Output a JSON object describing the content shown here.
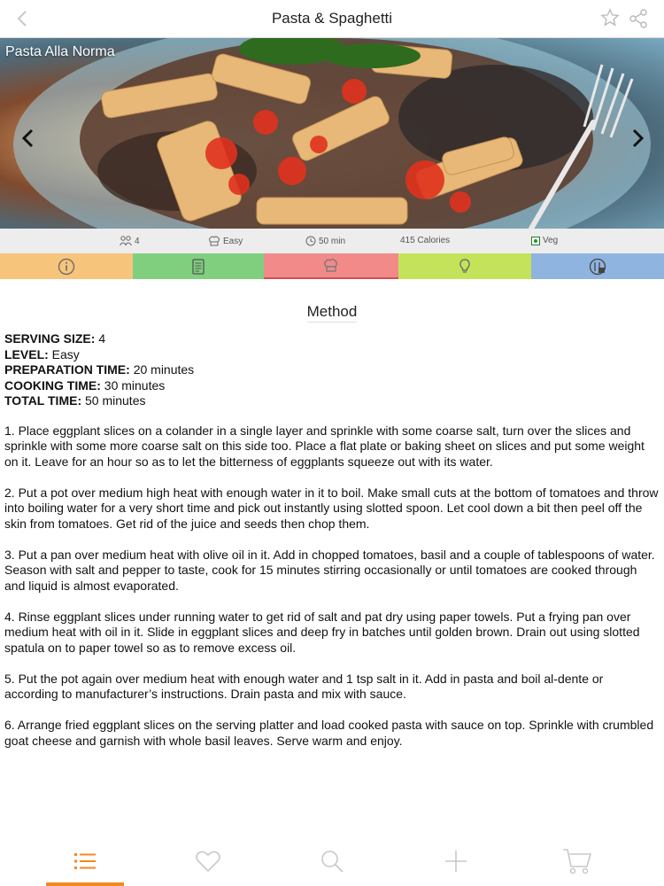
{
  "header": {
    "title": "Pasta & Spaghetti"
  },
  "hero": {
    "recipe_name": "Pasta Alla Norma"
  },
  "info": {
    "serves": "4",
    "level": "Easy",
    "time": "50 min",
    "calories": "415 Calories",
    "diet": "Veg"
  },
  "tabs": [
    {
      "icon": "info-icon",
      "color": "#f7c47c"
    },
    {
      "icon": "ingredients-list-icon",
      "color": "#7fcf7f"
    },
    {
      "icon": "chef-hat-icon",
      "color": "#f28a8a"
    },
    {
      "icon": "lightbulb-icon",
      "color": "#c4e35a"
    },
    {
      "icon": "nutrition-icon",
      "color": "#8fb4e0"
    }
  ],
  "method": {
    "title": "Method",
    "facts": [
      {
        "label": "SERVING SIZE:",
        "value": " 4"
      },
      {
        "label": "LEVEL:",
        "value": " Easy"
      },
      {
        "label": "PREPARATION TIME:",
        "value": " 20 minutes"
      },
      {
        "label": "COOKING TIME:",
        "value": " 30 minutes"
      },
      {
        "label": "TOTAL TIME:",
        "value": " 50 minutes"
      }
    ],
    "steps": [
      "1. Place eggplant slices on a colander in a single layer and sprinkle with some coarse salt, turn over the slices and sprinkle with some more coarse salt on this side too. Place a flat plate or baking sheet on slices and put some weight on it. Leave for an hour so as to let the bitterness of eggplants squeeze out with its water.",
      "2. Put a pot over medium high heat with enough water in it to boil. Make small cuts at the bottom of tomatoes and throw into boiling water for a very short time and pick out instantly using slotted spoon. Let cool down a bit then peel off the skin from tomatoes. Get rid of the juice and seeds then chop them.",
      "3. Put a pan over medium heat with olive oil in it. Add in chopped tomatoes, basil and a couple of tablespoons of water. Season with salt and pepper to taste, cook for 15 minutes stirring occasionally or until tomatoes are cooked through and liquid is almost evaporated.",
      "4. Rinse eggplant slices under running water to get rid of salt and pat dry using paper towels. Put a frying pan over medium heat with oil in it. Slide in eggplant slices and deep fry in batches until golden brown. Drain out using slotted spatula on to paper towel so as to remove excess oil.",
      "5.  Put the pot again over medium heat with enough water and 1 tsp salt in it. Add in pasta and boil al-dente or according to manufacturer’s instructions. Drain pasta and mix with sauce.",
      "6. Arrange fried eggplant slices on the serving platter and load cooked pasta with sauce on top. Sprinkle with crumbled goat cheese and garnish with whole basil leaves. Serve warm and enjoy."
    ]
  },
  "bottom_nav": [
    {
      "icon": "list-icon",
      "active": true
    },
    {
      "icon": "heart-icon",
      "active": false
    },
    {
      "icon": "search-icon",
      "active": false
    },
    {
      "icon": "plus-icon",
      "active": false
    },
    {
      "icon": "cart-icon",
      "active": false
    }
  ],
  "colors": {
    "accent": "#f28b1e",
    "inactive_icon": "#c8c8c8"
  }
}
